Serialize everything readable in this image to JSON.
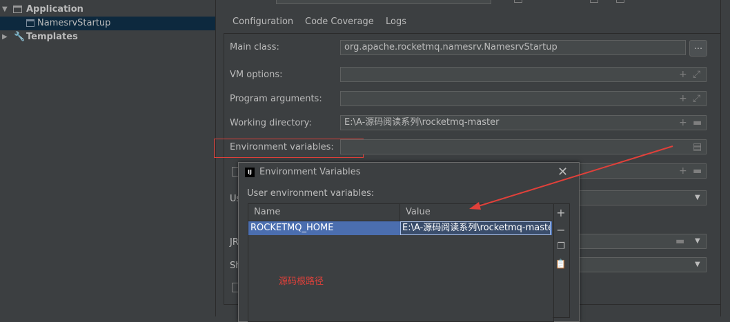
{
  "tree": {
    "items": [
      {
        "label": "Application"
      },
      {
        "label": "NamesrvStartup"
      },
      {
        "label": "Templates"
      }
    ]
  },
  "tabs": [
    {
      "label": "Configuration"
    },
    {
      "label": "Code Coverage"
    },
    {
      "label": "Logs"
    }
  ],
  "form": {
    "main_class_label": "Main class:",
    "main_class_value": "org.apache.rocketmq.namesrv.NamesrvStartup",
    "browse_button": "...",
    "vm_options_label": "VM options:",
    "program_args_label": "Program arguments:",
    "working_dir_label": "Working directory:",
    "working_dir_value": "E:\\A-源码阅读系列\\rocketmq-master",
    "env_vars_label": "Environment variables:",
    "partial_label_1": "Us",
    "partial_label_2": "JR",
    "partial_label_3": "Sh"
  },
  "dialog": {
    "title": "Environment Variables",
    "app_icon": "IJ",
    "user_env_label": "User environment variables:",
    "columns": [
      "Name",
      "Value"
    ],
    "rows": [
      {
        "name": "ROCKETMQ_HOME",
        "value": "E:\\A-源码阅读系列\\rocketmq-master"
      }
    ]
  },
  "annotation": {
    "text": "源码根路径"
  },
  "colors": {
    "accent": "#4a88c7",
    "selected_row": "#4b6eaf",
    "annotation": "#e0403a"
  }
}
